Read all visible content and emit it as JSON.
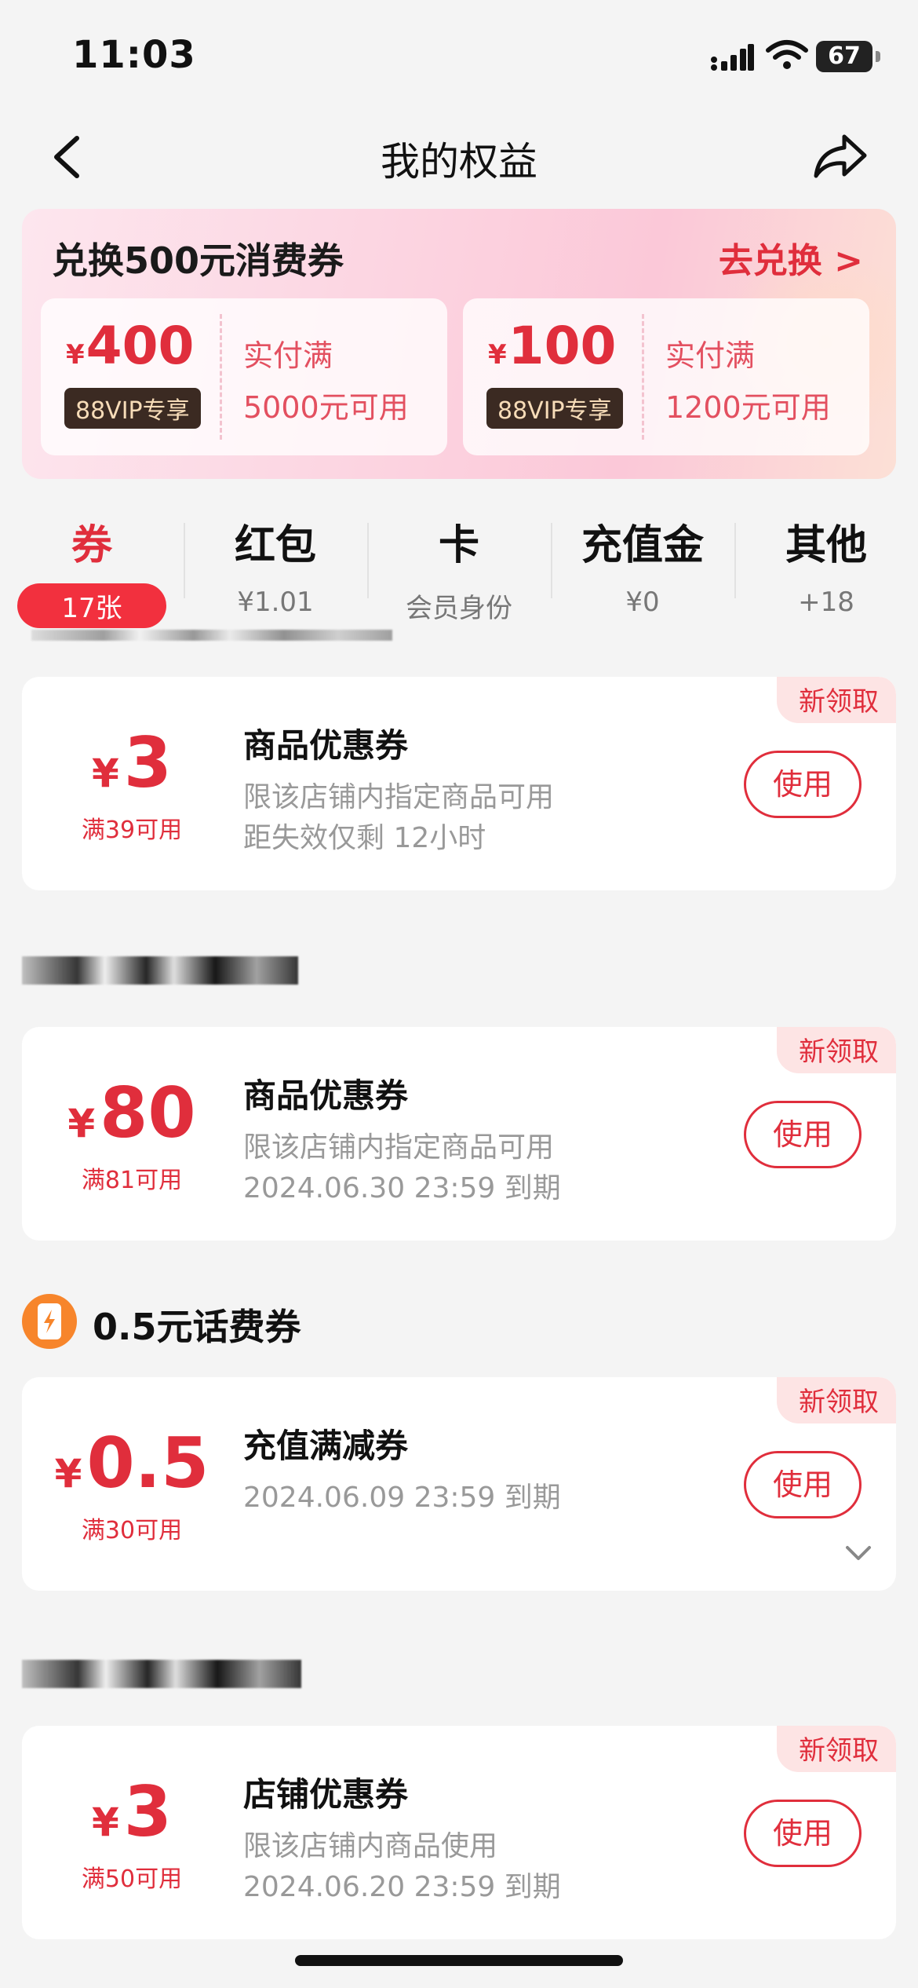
{
  "status_bar": {
    "time": "11:03",
    "battery": "67"
  },
  "nav": {
    "title": "我的权益"
  },
  "banner": {
    "title": "兑换500元消费券",
    "action": "去兑换 >",
    "tickets": [
      {
        "currency": "¥",
        "amount": "400",
        "tag": "88VIP专享",
        "cond1": "实付满",
        "cond2": "5000元可用"
      },
      {
        "currency": "¥",
        "amount": "100",
        "tag": "88VIP专享",
        "cond1": "实付满",
        "cond2": "1200元可用"
      }
    ]
  },
  "tabs": [
    {
      "name": "券",
      "sub": "17张",
      "active": true
    },
    {
      "name": "红包",
      "sub": "¥1.01"
    },
    {
      "name": "卡",
      "sub": "会员身份"
    },
    {
      "name": "充值金",
      "sub": "¥0"
    },
    {
      "name": "其他",
      "sub": "+18"
    }
  ],
  "groups": [
    {
      "store": "",
      "coupon": {
        "badge": "新领取",
        "currency": "¥",
        "value": "3",
        "min": "满39可用",
        "title": "商品优惠券",
        "line1": "限该店铺内指定商品可用",
        "line2": "距失效仅剩 12小时",
        "action": "使用"
      }
    },
    {
      "store": "",
      "coupon": {
        "badge": "新领取",
        "currency": "¥",
        "value": "80",
        "min": "满81可用",
        "title": "商品优惠券",
        "line1": "限该店铺内指定商品可用",
        "line2": "2024.06.30 23:59 到期",
        "action": "使用"
      }
    },
    {
      "store": "0.5元话费券",
      "coupon": {
        "badge": "新领取",
        "currency": "¥",
        "value": "0.5",
        "min": "满30可用",
        "title": "充值满减券",
        "line1": "2024.06.09 23:59 到期",
        "action": "使用"
      }
    },
    {
      "store": "",
      "coupon": {
        "badge": "新领取",
        "currency": "¥",
        "value": "3",
        "min": "满50可用",
        "title": "店铺优惠券",
        "line1": "限该店铺内商品使用",
        "line2": "2024.06.20 23:59 到期",
        "action": "使用"
      }
    }
  ]
}
